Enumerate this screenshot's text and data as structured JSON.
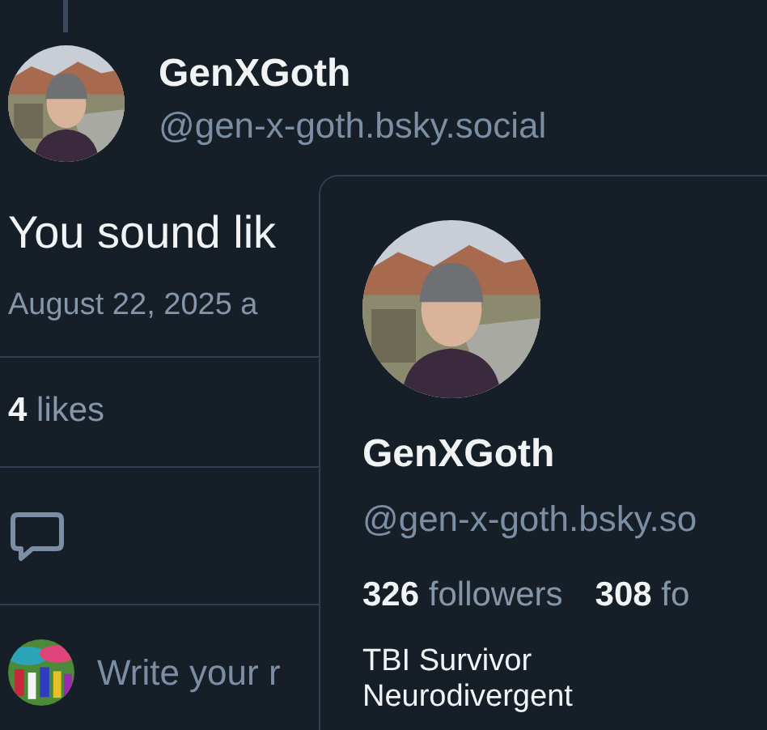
{
  "post": {
    "author": {
      "name": "GenXGoth",
      "handle": "@gen-x-goth.bsky.social"
    },
    "text": "You sound lik",
    "timestamp": "August 22, 2025 a",
    "likes": {
      "count": "4",
      "label": "likes"
    }
  },
  "reply_box": {
    "placeholder": "Write your r"
  },
  "profile_card": {
    "name": "GenXGoth",
    "handle": "@gen-x-goth.bsky.so",
    "stats": [
      {
        "count": "326",
        "label": "followers"
      },
      {
        "count": "308",
        "label": "fo"
      }
    ],
    "bio": [
      "TBI Survivor",
      "Neurodivergent"
    ]
  }
}
